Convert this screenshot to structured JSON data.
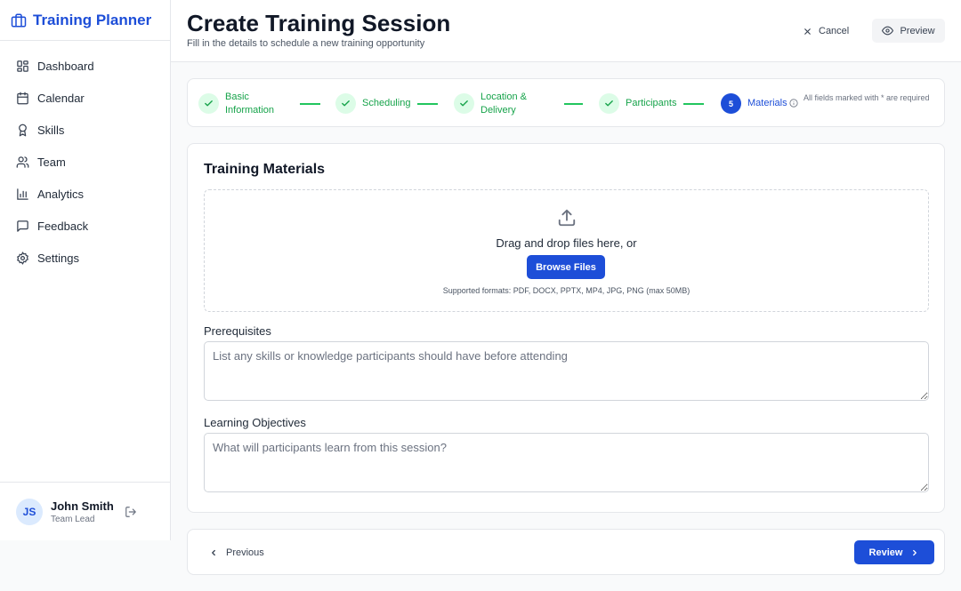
{
  "app": {
    "title": "Training Planner",
    "brand_icon": "briefcase-icon",
    "accent_color": "#1d4ed8",
    "success_color": "#16a34a"
  },
  "sidebar": {
    "items": [
      {
        "label": "Dashboard",
        "icon": "dashboard-icon"
      },
      {
        "label": "Calendar",
        "icon": "calendar-icon"
      },
      {
        "label": "Skills",
        "icon": "award-icon"
      },
      {
        "label": "Team",
        "icon": "users-icon"
      },
      {
        "label": "Analytics",
        "icon": "bar-chart-icon"
      },
      {
        "label": "Feedback",
        "icon": "message-icon"
      },
      {
        "label": "Settings",
        "icon": "gear-icon"
      }
    ]
  },
  "user": {
    "initials": "JS",
    "name": "John Smith",
    "role": "Team Lead"
  },
  "header": {
    "title": "Create Training Session",
    "subtitle": "Fill in the details to schedule a new training opportunity",
    "cancel_label": "Cancel",
    "preview_label": "Preview"
  },
  "stepper": {
    "steps": [
      {
        "label_line1": "Basic",
        "label_line2": "Information",
        "status": "complete"
      },
      {
        "label_line1": "Scheduling",
        "label_line2": "",
        "status": "complete"
      },
      {
        "label_line1": "Location &",
        "label_line2": "Delivery",
        "status": "complete"
      },
      {
        "label_line1": "Participants",
        "label_line2": "",
        "status": "complete"
      },
      {
        "number": "5",
        "label_line1": "Materials",
        "label_line2": "",
        "status": "active"
      }
    ],
    "required_note": "All fields marked with * are required"
  },
  "materials": {
    "title": "Training Materials",
    "drop_text": "Drag and drop files here, or",
    "browse_label": "Browse Files",
    "formats_text": "Supported formats: PDF, DOCX, PPTX, MP4, JPG, PNG (max 50MB)",
    "prerequisites": {
      "label": "Prerequisites",
      "placeholder": "List any skills or knowledge participants should have before attending",
      "value": ""
    },
    "objectives": {
      "label": "Learning Objectives",
      "placeholder": "What will participants learn from this session?",
      "value": ""
    }
  },
  "footer": {
    "previous_label": "Previous",
    "review_label": "Review"
  }
}
